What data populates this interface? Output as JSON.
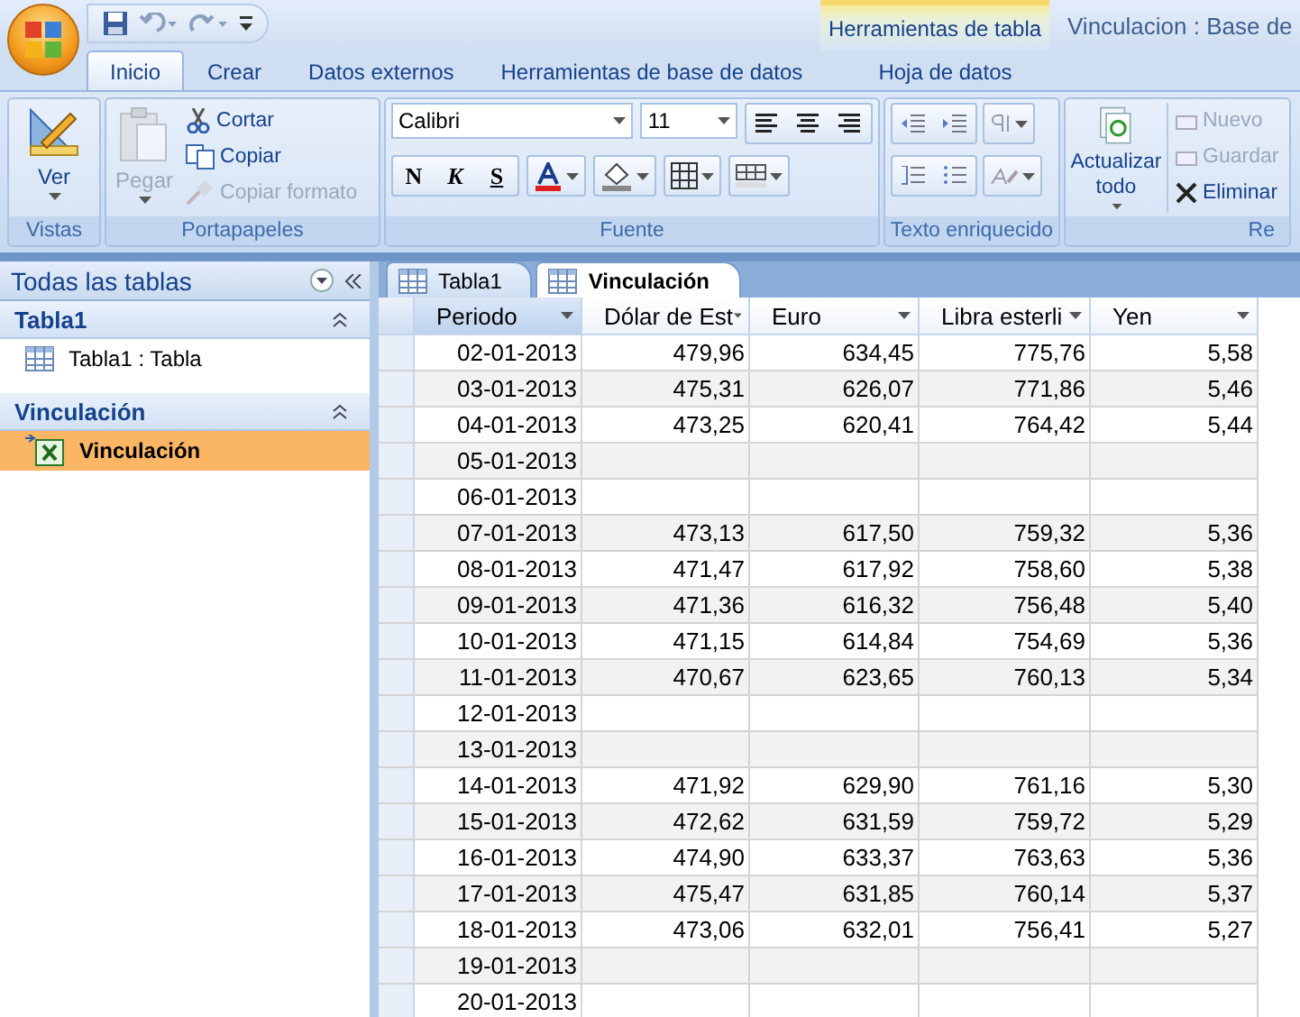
{
  "window": {
    "title": "Vinculacion : Base de",
    "context_tab_header": "Herramientas de tabla"
  },
  "ribbon_tabs": [
    {
      "label": "Inicio",
      "selected": true
    },
    {
      "label": "Crear",
      "selected": false
    },
    {
      "label": "Datos externos",
      "selected": false
    },
    {
      "label": "Herramientas de base de datos",
      "selected": false
    },
    {
      "label": "Hoja de datos",
      "selected": false
    }
  ],
  "ribbon": {
    "vistas": {
      "label": "Vistas",
      "view_button": "Ver"
    },
    "portapapeles": {
      "label": "Portapapeles",
      "paste": {
        "label": "Pegar",
        "disabled": true
      },
      "items": [
        {
          "label": "Cortar",
          "disabled": false
        },
        {
          "label": "Copiar",
          "disabled": false
        },
        {
          "label": "Copiar formato",
          "disabled": true
        }
      ]
    },
    "fuente": {
      "label": "Fuente",
      "font": "Calibri",
      "size": "11",
      "format_buttons": [
        "N",
        "K",
        "S"
      ]
    },
    "texto_enriquecido": {
      "label": "Texto enriquecido"
    },
    "registros": {
      "label": "Re",
      "refresh": "Actualizar todo",
      "items": [
        {
          "label": "Nuevo",
          "disabled": true
        },
        {
          "label": "Guardar",
          "disabled": true
        },
        {
          "label": "Eliminar",
          "disabled": false
        }
      ]
    }
  },
  "nav_pane": {
    "title": "Todas las tablas",
    "groups": [
      {
        "title": "Tabla1",
        "items": [
          {
            "label": "Tabla1 : Tabla",
            "kind": "table",
            "selected": false
          }
        ]
      },
      {
        "title": "Vinculación",
        "items": [
          {
            "label": "Vinculación",
            "kind": "excel",
            "selected": true
          }
        ]
      }
    ]
  },
  "document_tabs": [
    {
      "label": "Tabla1",
      "selected": false
    },
    {
      "label": "Vinculación",
      "selected": true
    }
  ],
  "table": {
    "columns": [
      "Periodo",
      "Dólar de Est",
      "Euro",
      "Libra esterli",
      "Yen"
    ],
    "rows": [
      {
        "cells": [
          "02-01-2013",
          "479,96",
          "634,45",
          "775,76",
          "5,58"
        ]
      },
      {
        "cells": [
          "03-01-2013",
          "475,31",
          "626,07",
          "771,86",
          "5,46"
        ]
      },
      {
        "cells": [
          "04-01-2013",
          "473,25",
          "620,41",
          "764,42",
          "5,44"
        ]
      },
      {
        "cells": [
          "05-01-2013"
        ]
      },
      {
        "cells": [
          "06-01-2013"
        ]
      },
      {
        "cells": [
          "07-01-2013",
          "473,13",
          "617,50",
          "759,32",
          "5,36"
        ]
      },
      {
        "cells": [
          "08-01-2013",
          "471,47",
          "617,92",
          "758,60",
          "5,38"
        ]
      },
      {
        "cells": [
          "09-01-2013",
          "471,36",
          "616,32",
          "756,48",
          "5,40"
        ]
      },
      {
        "cells": [
          "10-01-2013",
          "471,15",
          "614,84",
          "754,69",
          "5,36"
        ]
      },
      {
        "cells": [
          "11-01-2013",
          "470,67",
          "623,65",
          "760,13",
          "5,34"
        ]
      },
      {
        "cells": [
          "12-01-2013"
        ]
      },
      {
        "cells": [
          "13-01-2013"
        ]
      },
      {
        "cells": [
          "14-01-2013",
          "471,92",
          "629,90",
          "761,16",
          "5,30"
        ]
      },
      {
        "cells": [
          "15-01-2013",
          "472,62",
          "631,59",
          "759,72",
          "5,29"
        ]
      },
      {
        "cells": [
          "16-01-2013",
          "474,90",
          "633,37",
          "763,63",
          "5,36"
        ]
      },
      {
        "cells": [
          "17-01-2013",
          "475,47",
          "631,85",
          "760,14",
          "5,37"
        ]
      },
      {
        "cells": [
          "18-01-2013",
          "473,06",
          "632,01",
          "756,41",
          "5,27"
        ]
      },
      {
        "cells": [
          "19-01-2013"
        ]
      },
      {
        "cells": [
          "20-01-2013"
        ]
      }
    ]
  }
}
